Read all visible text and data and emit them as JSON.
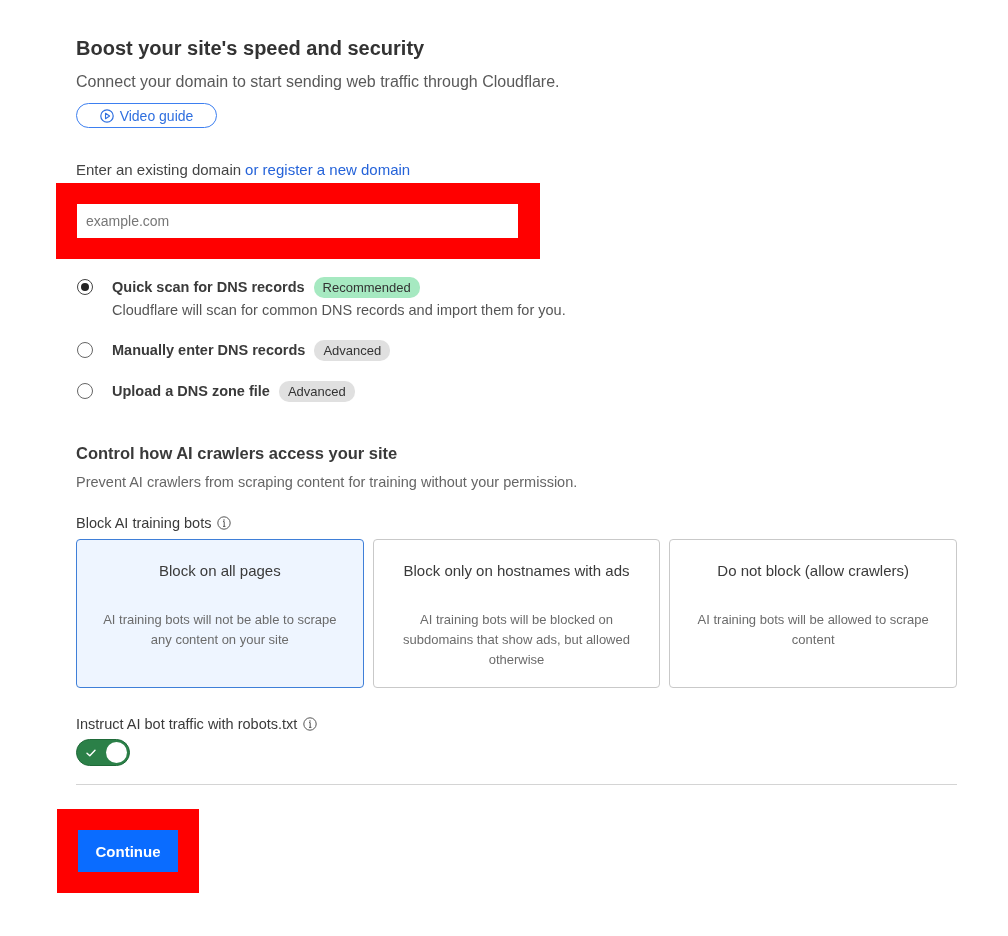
{
  "header": {
    "title": "Boost your site's speed and security",
    "subtitle": "Connect your domain to start sending web traffic through Cloudflare.",
    "video_button": "Video guide"
  },
  "domain": {
    "label": "Enter an existing domain",
    "link": "or register a new domain",
    "placeholder": "example.com"
  },
  "scan_options": [
    {
      "label": "Quick scan for DNS records",
      "badge": {
        "text": "Recommended",
        "color": "#a6e9c1"
      },
      "description": "Cloudflare will scan for common DNS records and import them for you.",
      "selected": true
    },
    {
      "label": "Manually enter DNS records",
      "badge": {
        "text": "Advanced",
        "color": "#e0e0e0"
      },
      "selected": false
    },
    {
      "label": "Upload a DNS zone file",
      "badge": {
        "text": "Advanced",
        "color": "#e0e0e0"
      },
      "selected": false
    }
  ],
  "ai_crawlers": {
    "title": "Control how AI crawlers access your site",
    "description": "Prevent AI crawlers from scraping content for training without your permission.",
    "block_label": "Block AI training bots",
    "options": [
      {
        "title": "Block on all pages",
        "description": "AI training bots will not be able to scrape any content on your site",
        "selected": true
      },
      {
        "title": "Block only on hostnames with ads",
        "description": "AI training bots will be blocked on subdomains that show ads, but allowed otherwise",
        "selected": false
      },
      {
        "title": "Do not block (allow crawlers)",
        "description": "AI training bots will be allowed to scrape content",
        "selected": false
      }
    ],
    "robots": {
      "label": "Instruct AI bot traffic with robots.txt",
      "on": true
    }
  },
  "continue_button": "Continue"
}
